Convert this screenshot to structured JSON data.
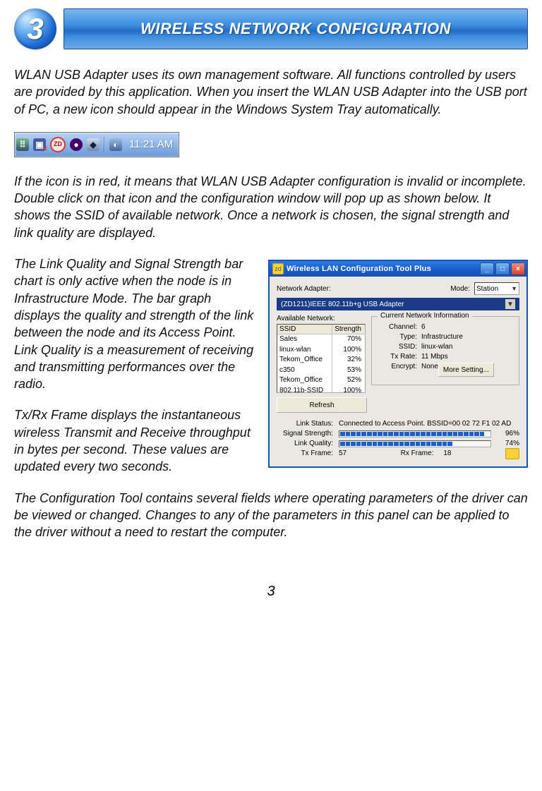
{
  "header": {
    "chapter_number": "3",
    "title": "WIRELESS NETWORK CONFIGURATION"
  },
  "paragraphs": {
    "p1": "WLAN USB Adapter uses its own management software. All functions controlled by users are provided by this application. When you insert the WLAN USB Adapter into the USB port of PC, a new icon should appear in the Windows System Tray automatically.",
    "p2": "If the icon is in red, it means that WLAN USB Adapter configuration is invalid or incomplete.   Double click on that icon and the configuration window will pop up as shown below.   It shows the SSID of available network. Once a network is chosen, the signal strength and link quality are displayed.",
    "p3": "The Link Quality and Signal Strength bar chart is only active when the node is in Infrastructure Mode. The bar graph displays the quality and strength of the link between the node and its Access Point.   Link Quality is a measurement of receiving and transmitting performances over the radio.",
    "p4": "Tx/Rx Frame displays the instantaneous wireless Transmit and Receive throughput in bytes per second. These values are updated every two seconds.",
    "p5": "The Configuration Tool contains several fields where operating parameters of the driver can be viewed or changed. Changes to any of the parameters in this panel can be applied to the driver without a need to restart the computer."
  },
  "systray": {
    "time": "11:21 AM",
    "highlight_icon_label": "ZD"
  },
  "window": {
    "title": "Wireless LAN Configuration Tool Plus",
    "adapter_label": "Network Adapter:",
    "adapter_value": "(ZD1211)IEEE 802.11b+g USB Adapter",
    "mode_label": "Mode:",
    "mode_value": "Station",
    "available_label": "Available Network:",
    "columns": {
      "ssid": "SSID",
      "strength": "Strength"
    },
    "networks": [
      {
        "ssid": "Sales",
        "strength": "70%"
      },
      {
        "ssid": "linux-wlan",
        "strength": "100%"
      },
      {
        "ssid": "Tekom_Office",
        "strength": "32%"
      },
      {
        "ssid": "c350",
        "strength": "53%"
      },
      {
        "ssid": "Tekom_Office",
        "strength": "52%"
      },
      {
        "ssid": "802.11b-SSID",
        "strength": "100%"
      }
    ],
    "refresh": "Refresh",
    "info": {
      "legend": "Current Network Information",
      "channel_label": "Channel:",
      "channel_value": "6",
      "type_label": "Type:",
      "type_value": "Infrastructure",
      "ssid_label": "SSID:",
      "ssid_value": "linux-wlan",
      "txrate_label": "Tx Rate:",
      "txrate_value": "11 Mbps",
      "encrypt_label": "Encrypt:",
      "encrypt_value": "None",
      "more_setting": "More Setting..."
    },
    "status": {
      "link_status_label": "Link Status:",
      "link_status_value": "Connected to Access Point. BSSID=00 02 72 F1 02 AD",
      "signal_label": "Signal Strength:",
      "signal_value": "96%",
      "quality_label": "Link Quality:",
      "quality_value": "74%",
      "tx_label": "Tx Frame:",
      "tx_value": "57",
      "rx_label": "Rx Frame:",
      "rx_value": "18"
    }
  },
  "page_number": "3",
  "chart_data": {
    "type": "bar",
    "title": "Available Network signal strength",
    "categories": [
      "Sales",
      "linux-wlan",
      "Tekom_Office",
      "c350",
      "Tekom_Office",
      "802.11b-SSID"
    ],
    "values": [
      70,
      100,
      32,
      53,
      52,
      100
    ],
    "ylabel": "Strength (%)",
    "ylim": [
      0,
      100
    ],
    "extra_metrics": {
      "Signal Strength": 96,
      "Link Quality": 74
    }
  }
}
